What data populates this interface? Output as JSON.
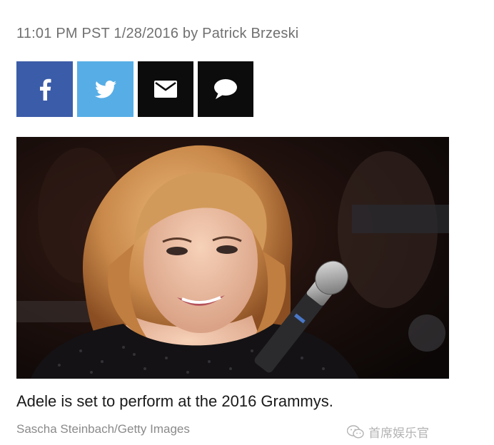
{
  "article": {
    "byline": "11:01 PM PST 1/28/2016 by Patrick Brzeski"
  },
  "share": {
    "buttons": [
      {
        "icon": "facebook-icon",
        "color": "#3b5ca8"
      },
      {
        "icon": "twitter-icon",
        "color": "#57aee6"
      },
      {
        "icon": "email-icon",
        "color": "#0c0c0c"
      },
      {
        "icon": "comment-icon",
        "color": "#0c0c0c"
      }
    ]
  },
  "photo": {
    "caption": "Adele is set to perform at the 2016 Grammys.",
    "credit": "Sascha Steinbach/Getty Images"
  },
  "watermark": {
    "text": "首席娱乐官",
    "icon": "wechat-icon"
  }
}
